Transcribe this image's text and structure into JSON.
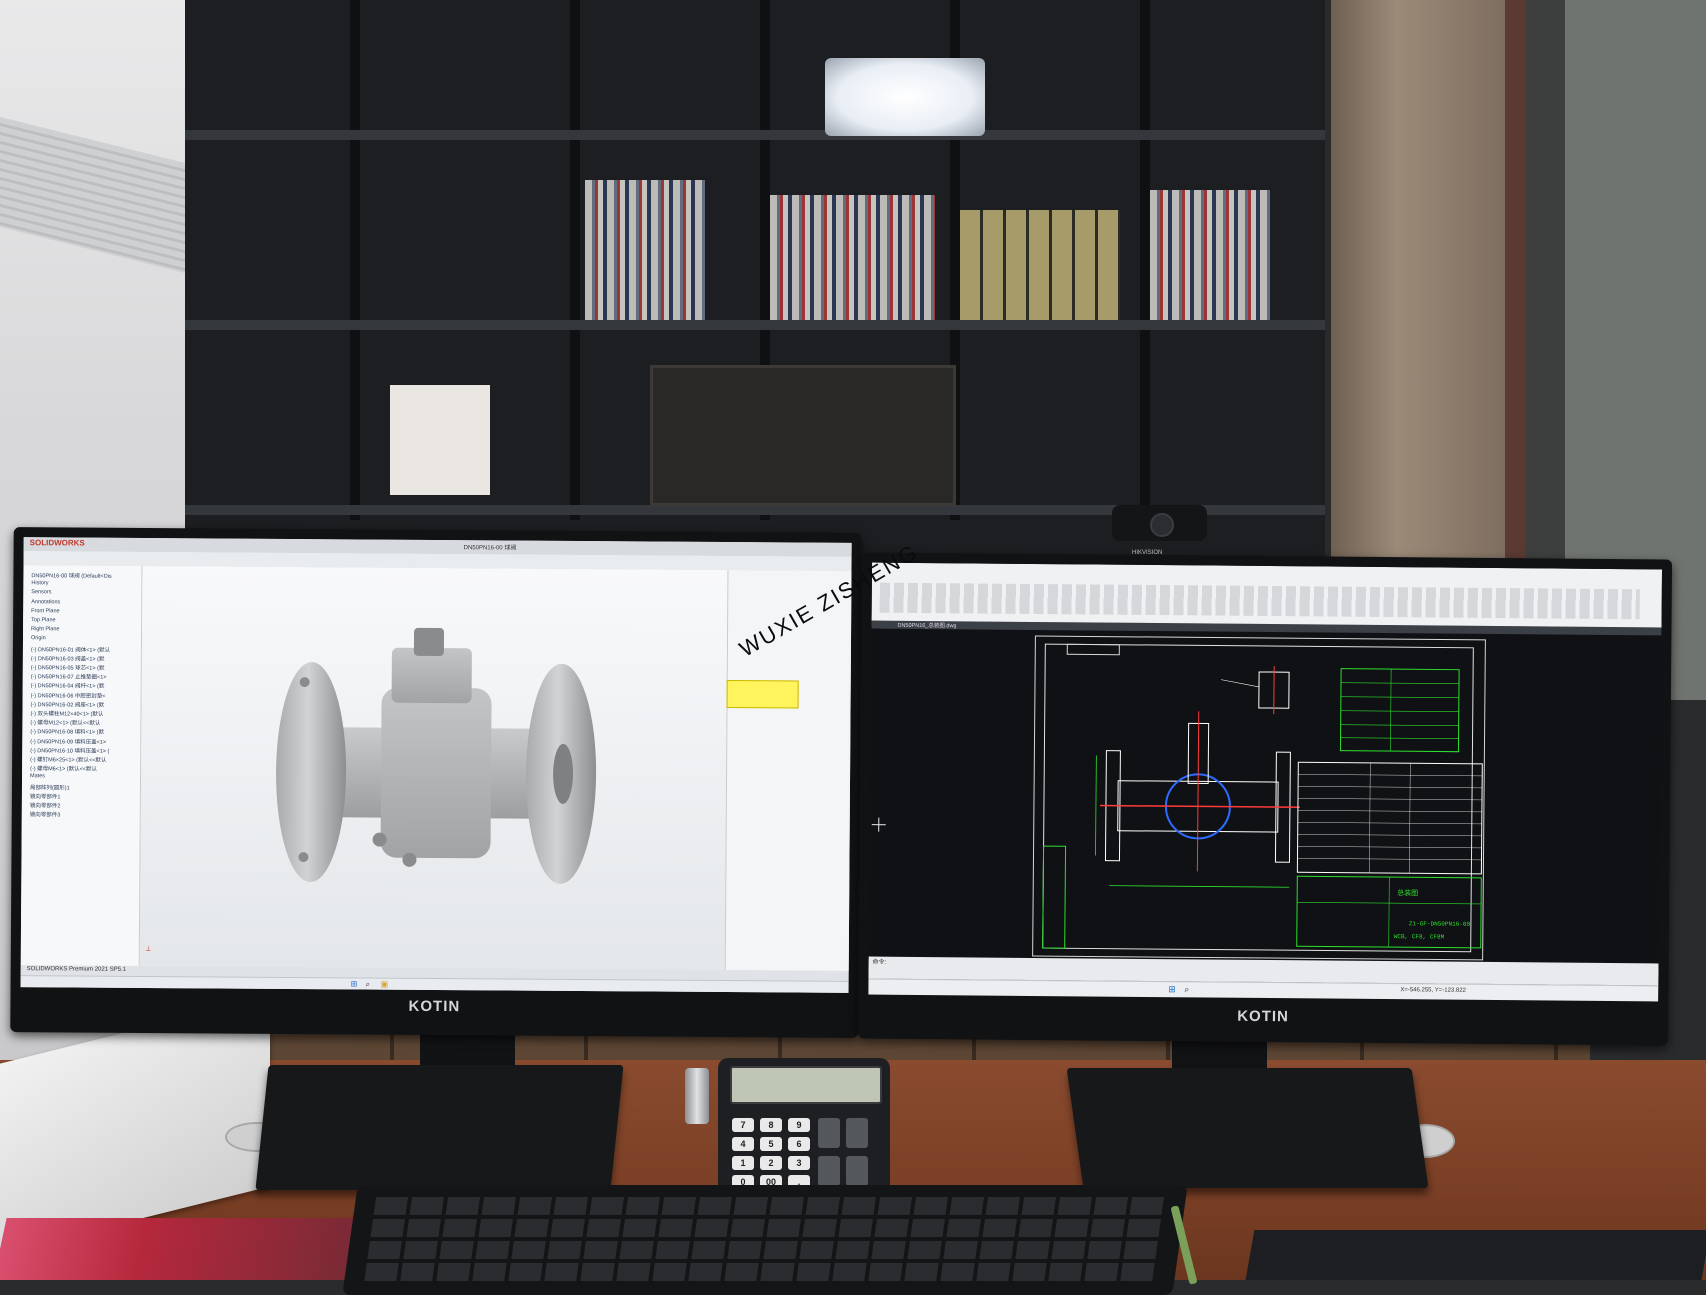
{
  "watermark": "WUXIE  ZISHENG",
  "monitors": {
    "left": {
      "brand": "KOTIN",
      "app": {
        "logo": "SOLIDWORKS",
        "doc_title": "DN50PN16-00 球阀",
        "status_text": "SOLIDWORKS Premium 2021 SP5.1",
        "tree_items": [
          "DN50PN16-00 球阀 (Default<Dis",
          "History",
          "Sensors",
          "Annotations",
          "Front Plane",
          "Top Plane",
          "Right Plane",
          "Origin",
          "(-) DN50PN16-01 阀体<1> (默认",
          "(-) DN50PN16-03 阀盖<1> (默",
          "(-) DN50PN16-05 球芯<1> (默",
          "(-) DN50PN16-07 止推垫圈<1>",
          "(-) DN50PN16-04 阀杆<1> (默",
          "(-) DN50PN16-06 中腔密封垫<",
          "(-) DN50PN16-02 阀座<1> (默",
          "(-) 双头螺柱M12×40<1> (默认",
          "(-) 螺母M12<1> (默认<<默认",
          "(-) DN50PN16-08 填料<1> (默",
          "(-) DN50PN16-09 填料压盖<1>",
          "(-) DN50PN16-10 填料压盖<1> (",
          "(-) 螺钉M6×25<1> (默认<<默认",
          "(-) 螺母M6<1> (默认<<默认",
          "Mates",
          "局部阵列(圆形)1",
          "镜向零部件1",
          "镜向零部件2",
          "镜向零部件3"
        ]
      },
      "icons": [
        "solidworks-logo-icon",
        "home-icon",
        "folder-icon",
        "save-icon",
        "search-icon",
        "windows-start-icon"
      ],
      "colors": {
        "viewport": "#f0f2f4",
        "model": "#b8b9bb",
        "tooltip": "#fff45c"
      }
    },
    "right": {
      "brand": "KOTIN",
      "app": {
        "file_tab": "DN50PN16_总装图.dwg",
        "title_block": "Z1-GF-DN50PN16-00",
        "material_note": "WCB, CF8, CF8M",
        "drawing_title": "总装图",
        "command_label": "命令:",
        "coordinates": "X=-546.255, Y=-123.822"
      },
      "icons": [
        "crosshair-cursor-icon",
        "windows-start-icon",
        "search-icon"
      ],
      "colors": {
        "model_space": "#0f1114",
        "lines": "#ffffff",
        "section": "#ff3b3b",
        "dimension": "#2ee02e",
        "hatch": "#2e6bff"
      }
    }
  },
  "webcam": {
    "label": "HIKVISION"
  },
  "calculator": {
    "keys": [
      "7",
      "8",
      "9",
      "4",
      "5",
      "6",
      "1",
      "2",
      "3",
      "0",
      "00",
      "."
    ]
  }
}
